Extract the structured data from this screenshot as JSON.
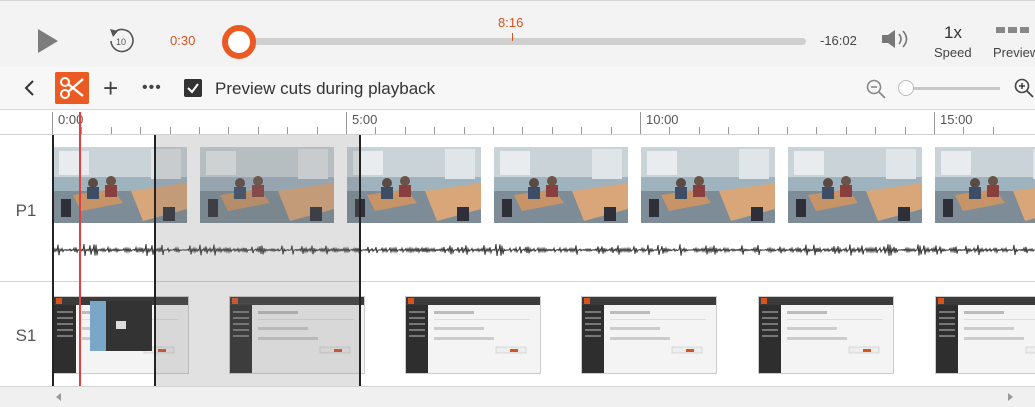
{
  "player": {
    "current_time": "0:30",
    "marker_time": "8:16",
    "remaining_time": "-16:02",
    "rewind_seconds": "10",
    "speed_value": "1x",
    "speed_label": "Speed",
    "preview_label": "Preview",
    "progress_fraction": 0.0,
    "icons": [
      "play-icon",
      "rewind-10-icon",
      "volume-icon",
      "preview-icon"
    ],
    "accent_color": "#ec5a24"
  },
  "toolbar": {
    "preview_cuts_label": "Preview cuts during playback",
    "preview_cuts_checked": true,
    "icons": [
      "back-chevron-icon",
      "scissors-icon",
      "plus-icon",
      "more-icon",
      "zoom-out-icon",
      "zoom-in-icon"
    ]
  },
  "ruler": {
    "labels": [
      "0:00",
      "5:00",
      "10:00",
      "15:00"
    ]
  },
  "tracks": [
    {
      "label": "P1"
    },
    {
      "label": "S1"
    }
  ]
}
